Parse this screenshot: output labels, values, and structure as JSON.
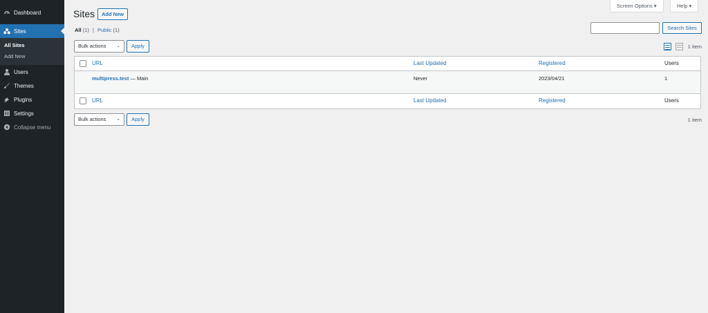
{
  "sidebar": {
    "items": [
      {
        "label": "Dashboard",
        "icon": "dashboard-icon"
      },
      {
        "label": "Sites",
        "icon": "sites-icon"
      },
      {
        "label": "Users",
        "icon": "users-icon"
      },
      {
        "label": "Themes",
        "icon": "themes-icon"
      },
      {
        "label": "Plugins",
        "icon": "plugins-icon"
      },
      {
        "label": "Settings",
        "icon": "settings-icon"
      }
    ],
    "submenu": [
      {
        "label": "All Sites"
      },
      {
        "label": "Add New"
      }
    ],
    "collapse_label": "Collapse menu"
  },
  "header": {
    "title": "Sites",
    "add_new": "Add New",
    "screen_options": "Screen Options ▾",
    "help": "Help ▾"
  },
  "filters": {
    "all_label": "All",
    "all_count": "(1)",
    "separator": "|",
    "public_label": "Public",
    "public_count": "(1)"
  },
  "search": {
    "placeholder": "",
    "button": "Search Sites"
  },
  "bulk": {
    "label": "Bulk actions",
    "apply": "Apply"
  },
  "items_count": "1 item",
  "table": {
    "columns": [
      "URL",
      "Last Updated",
      "Registered",
      "Users"
    ],
    "rows": [
      {
        "site": "multipress.test",
        "suffix": " — Main",
        "last_updated": "Never",
        "registered": "2023/04/21",
        "users": "1"
      }
    ]
  },
  "colors": {
    "accent": "#2271b1",
    "menu_bg": "#1d2327",
    "content_bg": "#f0f0f1"
  }
}
